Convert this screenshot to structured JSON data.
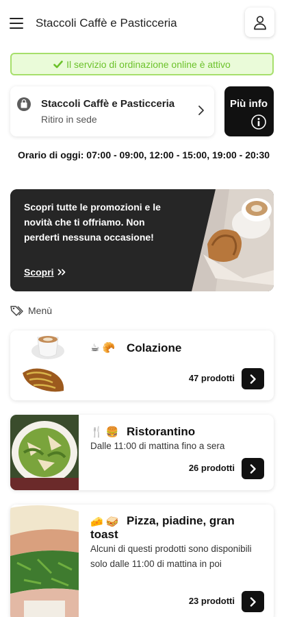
{
  "header": {
    "title": "Staccoli Caffè e Pasticceria",
    "menu_icon": "hamburger-menu-icon",
    "user_icon": "user-icon"
  },
  "banner": {
    "text": "Il servizio di ordinazione online è attivo",
    "icon": "check-icon",
    "color": "#6cc22b"
  },
  "store": {
    "name": "Staccoli Caffè e Pasticceria",
    "mode": "Ritiro in sede",
    "icon": "shopping-bag-icon"
  },
  "info_button": {
    "label": "Più info",
    "icon": "info-circle-icon"
  },
  "hours": {
    "text": "Orario di oggi: 07:00 - 09:00, 12:00 - 15:00, 19:00 - 20:30"
  },
  "promo": {
    "text": "Scopri tutte le promozioni e le novità che ti offriamo. Non perderti nessuna occasione!",
    "link_label": "Scopri",
    "link_icon": "double-chevron-right-icon"
  },
  "menu_section": {
    "label": "Menù",
    "icon": "tags-icon"
  },
  "categories": [
    {
      "emojis": "☕ 🥐",
      "title": "Colazione",
      "description": "",
      "count": "47 prodotti"
    },
    {
      "emojis": "🍴 🍔",
      "title": "Ristorantino",
      "description": "Dalle 11:00 di mattina fino a sera",
      "count": "26 prodotti"
    },
    {
      "emojis": "🧀 🥪",
      "title": "Pizza, piadine, gran toast",
      "description": "Alcuni di questi prodotti sono disponibili solo dalle 11:00 di mattina in poi",
      "count": "23 prodotti"
    }
  ],
  "colors": {
    "accent_dark": "#111111",
    "banner_bg": "#eafbd9",
    "banner_border": "#a6df6b"
  }
}
